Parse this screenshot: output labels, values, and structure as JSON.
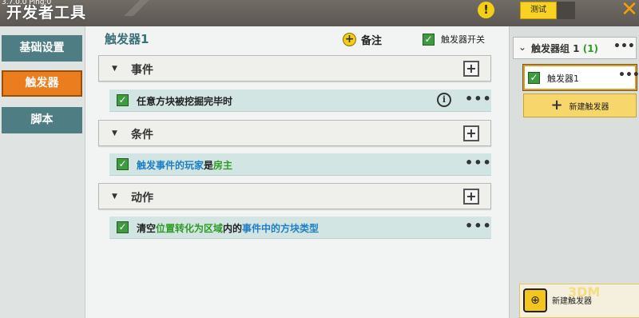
{
  "window": {
    "version": "3.7.0.0 Ping:0",
    "title": "开发者工具",
    "test_label": "测试",
    "warn_icon": "warning-icon",
    "close_icon": "close-x-icon"
  },
  "nav": {
    "items": [
      {
        "label": "基础设置",
        "active": false
      },
      {
        "label": "触发器",
        "active": true
      },
      {
        "label": "脚本",
        "active": false
      }
    ]
  },
  "main": {
    "title": "触发器1",
    "note_label": "备注",
    "trigger_switch_label": "触发器开关",
    "trigger_switch_on": true,
    "sections": [
      {
        "label": "事件",
        "rows": [
          {
            "parts": [
              {
                "text": "任意方块被挖掘完毕时",
                "color": "default"
              }
            ],
            "has_info": true
          }
        ]
      },
      {
        "label": "条件",
        "rows": [
          {
            "parts": [
              {
                "text": "触发事件的玩家",
                "color": "blue"
              },
              {
                "text": "是",
                "color": "default"
              },
              {
                "text": "房主",
                "color": "green"
              }
            ],
            "has_info": false
          }
        ]
      },
      {
        "label": "动作",
        "rows": [
          {
            "parts": [
              {
                "text": "清空",
                "color": "default"
              },
              {
                "text": "位置转化为区域",
                "color": "green"
              },
              {
                "text": "内的",
                "color": "default"
              },
              {
                "text": "事件中的方块类型",
                "color": "blue"
              }
            ],
            "has_info": false
          }
        ]
      }
    ],
    "more_label": "•••",
    "add_label": "+"
  },
  "right": {
    "group_label": "触发器组 1",
    "group_count": "(1)",
    "group_more": "•••",
    "trigger_item_label": "触发器1",
    "trigger_item_more": "•••",
    "new_trigger_label": "新建触发器",
    "bottom_label": "新建触发器",
    "watermark": "3DM"
  },
  "colors": {
    "accent_orange": "#eb7d1e",
    "nav_teal": "#4e7e83",
    "check_green": "#3f9b3f",
    "highlight_blue": "#1f7fc4",
    "highlight_green": "#2f9b24",
    "yellow": "#f7d222"
  }
}
